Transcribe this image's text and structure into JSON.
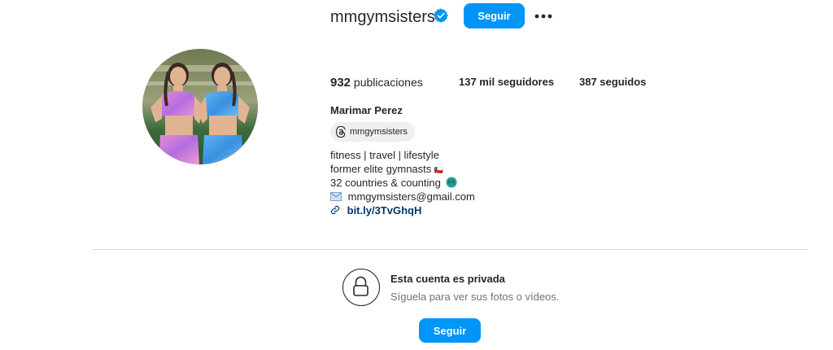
{
  "header": {
    "username": "mmgymsisters",
    "follow_label": "Seguir",
    "verified_icon": "verified-badge-icon",
    "more_icon": "more-options-icon"
  },
  "stats": {
    "posts_count": "932",
    "posts_label": "publicaciones",
    "followers": "137 mil seguidores",
    "following": "387 seguidos"
  },
  "profile": {
    "full_name": "Marimar Perez",
    "threads_handle": "mmgymsisters",
    "bio_lines": [
      "fitness | travel | lifestyle",
      "former elite gymnasts",
      "32 countries & counting",
      "mmgymsisters@gmail.com"
    ],
    "link": "bit.ly/3TvGhqH"
  },
  "private_notice": {
    "title": "Esta cuenta es privada",
    "subtitle": "Síguela para ver sus fotos o vídeos.",
    "follow_label": "Seguir"
  },
  "colors": {
    "accent": "#0095f6",
    "link": "#00376b",
    "muted": "#737373"
  }
}
